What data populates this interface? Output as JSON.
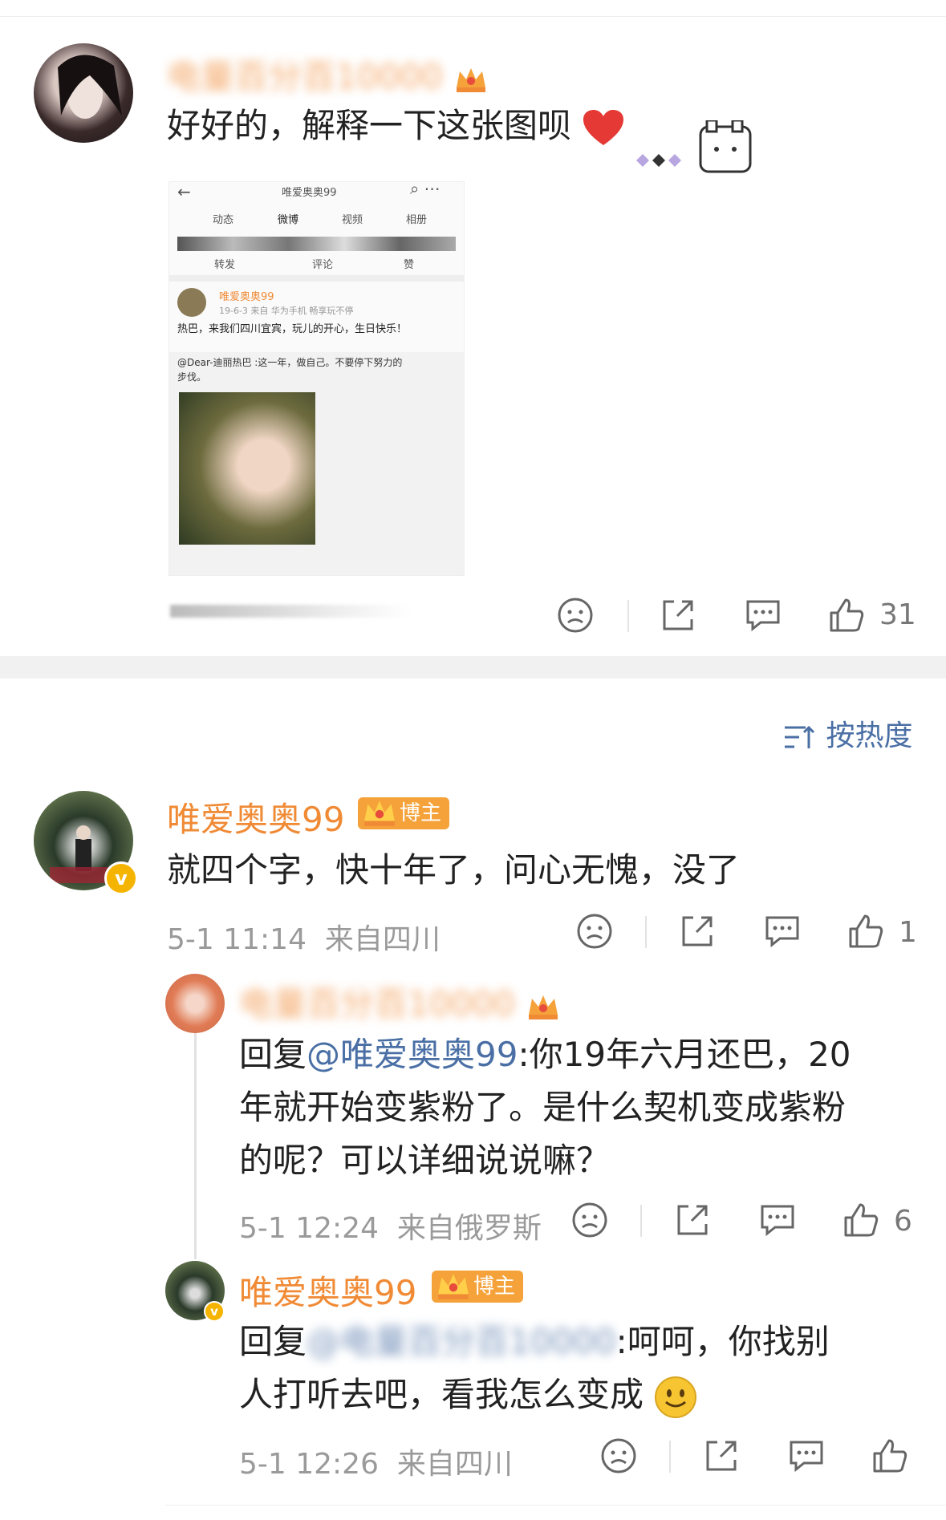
{
  "top_comment": {
    "username": "电量百分百10000",
    "text": "好好的，解释一下这张图呗",
    "like_count": "31"
  },
  "embedded_screenshot": {
    "header_title": "唯爱奥奥99",
    "tabs": [
      "动态",
      "微博",
      "视频",
      "相册"
    ],
    "actions": [
      "转发",
      "评论",
      "赞"
    ],
    "post_user": "唯爱奥奥99",
    "post_meta": "19-6-3  来自 华为手机 畅享玩不停",
    "post_text": "热巴，来我们四川宜宾，玩儿的开心，生日快乐！",
    "quote_text_line1": "@Dear-迪丽热巴 :这一年，做自己。不要停下努力的",
    "quote_text_line2": "步伐。"
  },
  "sort": {
    "label": "按热度"
  },
  "comment1": {
    "username": "唯爱奥奥99",
    "badge": "博主",
    "text": "就四个字，快十年了，问心无愧，没了",
    "time": "5-1 11:14",
    "location": "来自四川",
    "like_count": "1"
  },
  "reply1": {
    "username": "电量百分百10000",
    "prefix": "回复",
    "mention": "@唯爱奥奥99",
    "line1": ":你19年六月还巴，20",
    "line2": "年就开始变紫粉了。是什么契机变成紫粉",
    "line3": "的呢？可以详细说说嘛？",
    "time": "5-1 12:24",
    "location": "来自俄罗斯",
    "like_count": "6"
  },
  "reply2": {
    "username": "唯爱奥奥99",
    "badge": "博主",
    "prefix": "回复",
    "mention": "@电量百分百10000",
    "line1": ":呵呵，你找别",
    "line2": "人打听去吧，看我怎么变成",
    "time": "5-1 12:26",
    "location": "来自四川"
  },
  "colors": {
    "username": "#f08a35",
    "mention": "#4a6fa5",
    "meta": "#9a9a9a",
    "badge": "#f5a23a"
  }
}
